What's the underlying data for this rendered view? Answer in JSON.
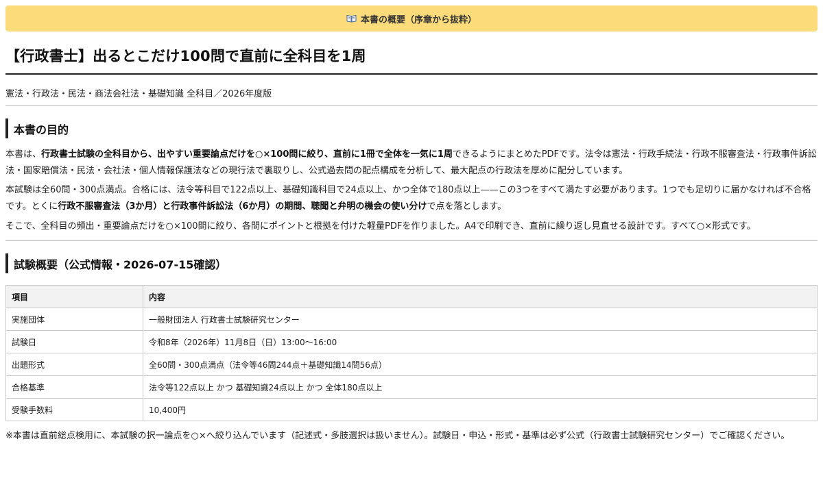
{
  "banner": {
    "icon": "book-icon",
    "text": "本書の概要（序章から抜粋）"
  },
  "title": "【行政書士】出るとこだけ100問で直前に全科目を1周",
  "subtitle": "憲法・行政法・民法・商法会社法・基礎知識 全科目／2026年度版",
  "section_purpose": {
    "heading": "本書の目的",
    "p1": {
      "a": "本書は、",
      "b": "行政書士試験の全科目から、出やすい重要論点だけを○×100問に絞り、直前に1冊で全体を一気に1周",
      "c": "できるようにまとめたPDFです。法令は憲法・行政手続法・行政不服審査法・行政事件訴訟法・国家賠償法・民法・会社法・個人情報保護法などの現行法で裏取りし、公式過去問の配点構成を分析して、最大配点の行政法を厚めに配分しています。"
    },
    "p2": {
      "a": "本試験は全60問・300点満点。合格には、法令等科目で122点以上、基礎知識科目で24点以上、かつ全体で180点以上——この3つをすべて満たす必要があります。1つでも足切りに届かなければ不合格です。とくに",
      "b": "行政不服審査法（3か月）と行政事件訴訟法（6か月）の期間、聴聞と弁明の機会の使い分け",
      "c": "で点を落とします。"
    },
    "p3": "そこで、全科目の頻出・重要論点だけを○×100問に絞り、各問にポイントと根拠を付けた軽量PDFを作りました。A4で印刷でき、直前に繰り返し見直せる設計です。すべて○×形式です。"
  },
  "section_exam": {
    "heading": "試験概要（公式情報・2026-07-15確認）",
    "table": {
      "headers": [
        "項目",
        "内容"
      ],
      "rows": [
        [
          "実施団体",
          "一般財団法人 行政書士試験研究センター"
        ],
        [
          "試験日",
          "令和8年（2026年）11月8日（日）13:00〜16:00"
        ],
        [
          "出題形式",
          "全60問・300点満点（法令等46問244点＋基礎知識14問56点）"
        ],
        [
          "合格基準",
          "法令等122点以上 かつ 基礎知識24点以上 かつ 全体180点以上"
        ],
        [
          "受験手数料",
          "10,400円"
        ]
      ]
    }
  },
  "note": "※本書は直前総点検用に、本試験の択一論点を○×へ絞り込んでいます（記述式・多肢選択は扱いません）。試験日・申込・形式・基準は必ず公式（行政書士試験研究センター）でご確認ください。"
}
